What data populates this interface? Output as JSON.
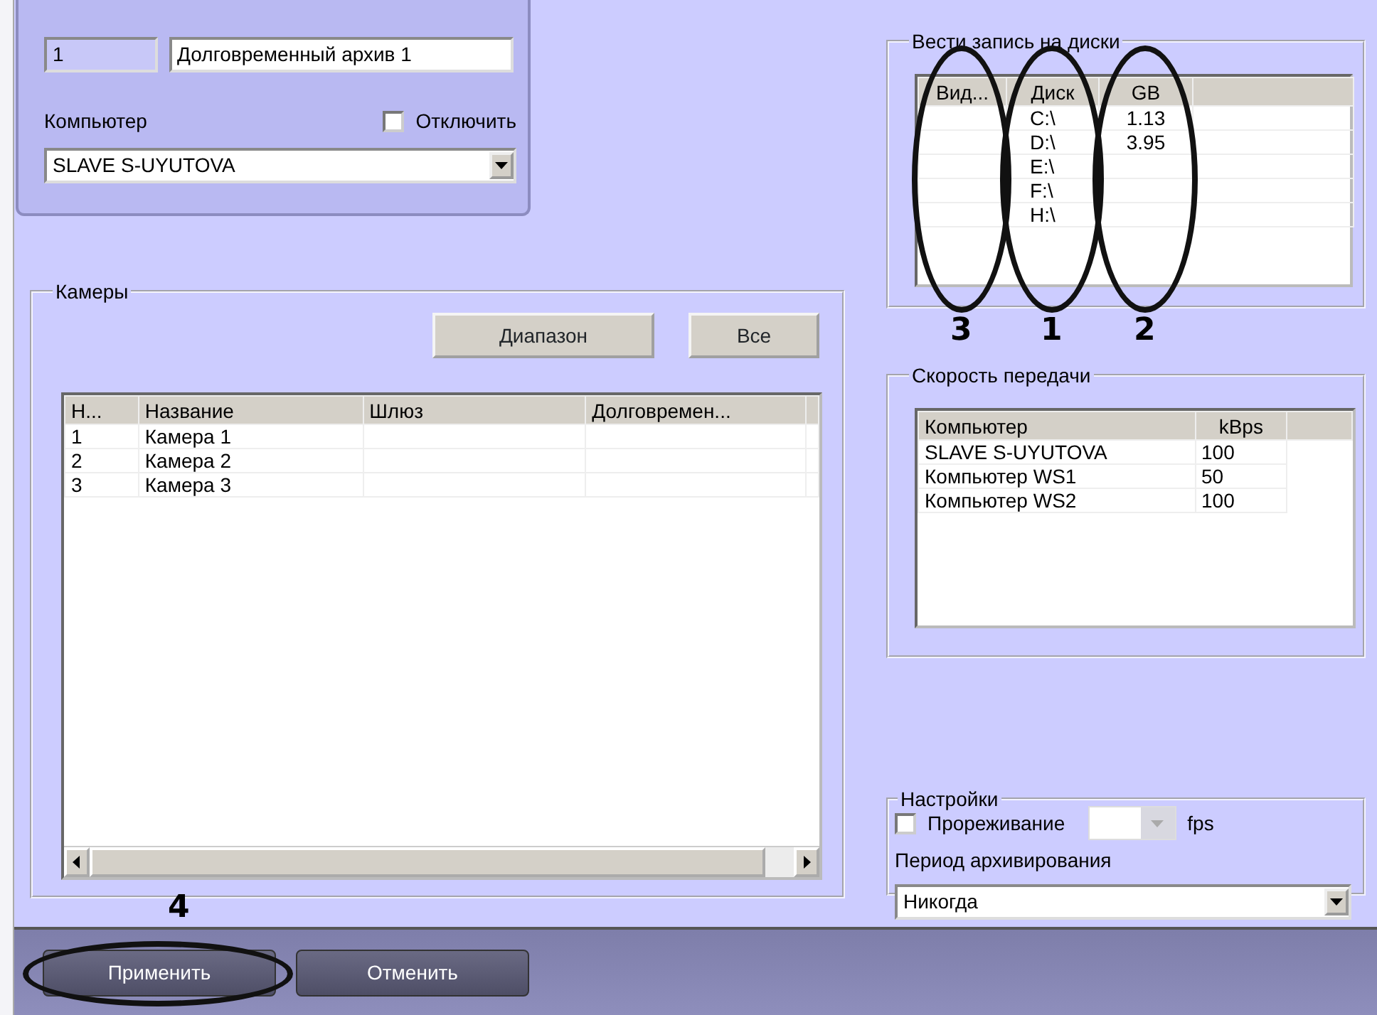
{
  "archive": {
    "number": "1",
    "name": "Долговременный архив 1",
    "computer_label": "Компьютер",
    "disable": {
      "label": "Отключить",
      "checked": false
    },
    "computer": "SLAVE S-UYUTOVA"
  },
  "cameras": {
    "title": "Камеры",
    "buttons": [
      "Диапазон",
      "Все"
    ],
    "columns": [
      "Н...",
      "Название",
      "Шлюз",
      "Долговремен..."
    ],
    "rows": [
      {
        "number": "1",
        "name": "Камера 1"
      },
      {
        "number": "2",
        "name": "Камера 2"
      },
      {
        "number": "3",
        "name": "Камера 3"
      }
    ]
  },
  "disks": {
    "title": "Вести запись на диски",
    "columns": [
      {
        "label": "Вид...",
        "annotation": "3"
      },
      {
        "label": "Диск",
        "annotation": "1"
      },
      {
        "label": "GB",
        "annotation": "2"
      }
    ],
    "rows": [
      {
        "drive": "C:\\",
        "gb": "1.13"
      },
      {
        "drive": "D:\\",
        "gb": "3.95"
      },
      {
        "drive": "E:\\"
      },
      {
        "drive": "F:\\"
      },
      {
        "drive": "H:\\"
      }
    ]
  },
  "speed": {
    "title": "Скорость передачи",
    "columns": [
      "Компьютер",
      "kBps"
    ],
    "rows": [
      {
        "computer": "SLAVE S-UYUTOVA",
        "kbps": "100"
      },
      {
        "computer": "Компьютер WS1",
        "kbps": "50"
      },
      {
        "computer": "Компьютер WS2",
        "kbps": "100"
      }
    ]
  },
  "settings": {
    "title": "Настройки",
    "thinning": {
      "label": "Прореживание",
      "checked": false
    },
    "fps_unit": "fps",
    "period_label": "Период архивирования",
    "period": "Никогда"
  },
  "buttons": [
    {
      "label": "Применить",
      "annotation": "4"
    },
    {
      "label": "Отменить"
    }
  ]
}
